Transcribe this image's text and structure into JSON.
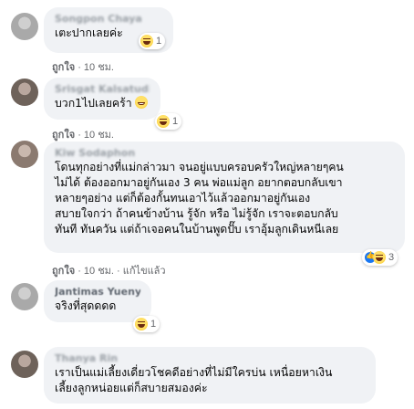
{
  "comments": [
    {
      "author": "Songpon Chaya",
      "text": "เตะปากเลยค่ะ",
      "meta": {
        "like": "ถูกใจ",
        "sep": " · ",
        "time": "10 ชม."
      },
      "reaction_count": "1"
    },
    {
      "author": "Srisgat Kalsatudin",
      "text": "บวก1ไปเลยคร้า",
      "meta": {
        "like": "ถูกใจ",
        "sep": " · ",
        "time": "10 ชม."
      },
      "reaction_count": "1"
    },
    {
      "author": "Kiw Sodaphon",
      "text": "โดนทุกอย่างที่แม่กล่าวมา จนอยู่แบบครอบครัวใหญ่หลายๆคน\nไม่ได้ ต้องออกมาอยู่กันเอง 3 คน พ่อแม่ลูก อยากตอบกลับเขา\nหลายๆอย่าง แต่ก็ต้องกั้นทนเอาไว้แล้วออกมาอยู่กันเอง\nสบายใจกว่า ถ้าคนข้างบ้าน รู้จัก หรือ ไม่รู้จัก เราจะตอบกลับ\nทันที ทันควัน แต่ถ้าเจอคนในบ้านพูดปั๊บ เราอุ้มลูกเดินหนีเลย",
      "meta": {
        "like": "ถูกใจ",
        "sep": " · ",
        "time": "10 ชม.",
        "edited": "แก้ไขแล้ว"
      },
      "reaction_count": "3"
    },
    {
      "author": "Jantimas Yuenyong",
      "text": "จริงที่สุดดดด",
      "meta": {
        "like": "ถูกใจ",
        "sep": " · ",
        "time": "10 ชม."
      },
      "reaction_count": "1"
    },
    {
      "author": "Thanya Rin",
      "text": "เราเป็นแม่เลี้ยงเดี่ยวโชคดีอย่างที่ไม่มีใครบ่น เหนื่อยหาเงิน\nเลี้ยงลูกหน่อยแต่ก็สบายสมองค่ะ",
      "meta": {},
      "reaction_count": ""
    }
  ],
  "colors": {
    "bubble": "#f0f2f5",
    "meta": "#65676b",
    "like_blue": "#1877f2"
  },
  "icons": [
    "haha-emoji",
    "grin-emoji",
    "like-emoji"
  ]
}
